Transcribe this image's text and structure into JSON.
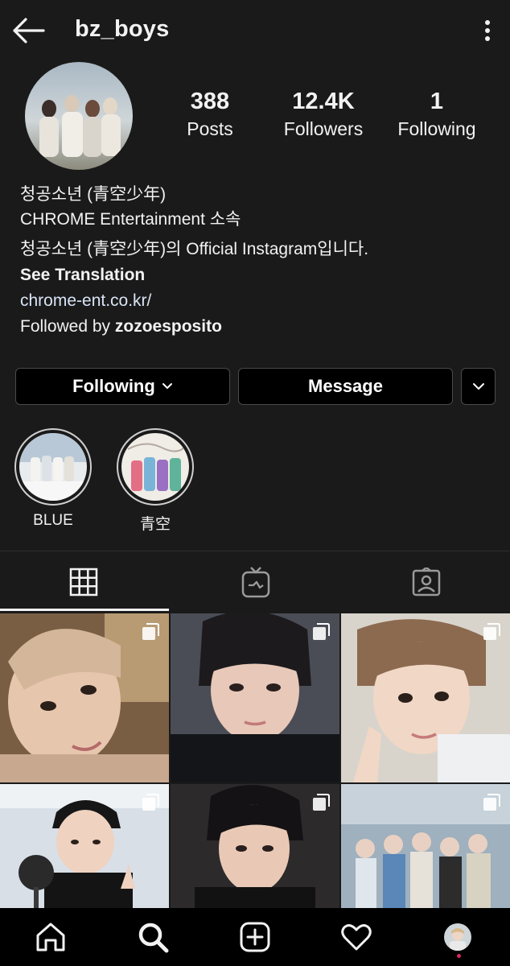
{
  "header": {
    "username": "bz_boys"
  },
  "stats": {
    "posts": {
      "value": "388",
      "label": "Posts"
    },
    "followers": {
      "value": "12.4K",
      "label": "Followers"
    },
    "following": {
      "value": "1",
      "label": "Following"
    }
  },
  "bio": {
    "name": "청공소년 (青空少年)",
    "category": "CHROME Entertainment 소속",
    "description": "청공소년 (青空少年)의 Official Instagram입니다.",
    "see_translation": "See Translation",
    "website": "chrome-ent.co.kr/",
    "followed_by_prefix": "Followed by ",
    "followed_by_user": "zozoesposito"
  },
  "actions": {
    "following_label": "Following",
    "message_label": "Message"
  },
  "highlights": [
    {
      "label": "BLUE"
    },
    {
      "label": "青空"
    }
  ],
  "tabs": [
    "grid-icon",
    "igtv-icon",
    "tagged-icon"
  ],
  "nav": [
    "home-icon",
    "search-icon",
    "add-post-icon",
    "activity-heart-icon",
    "profile-avatar"
  ]
}
